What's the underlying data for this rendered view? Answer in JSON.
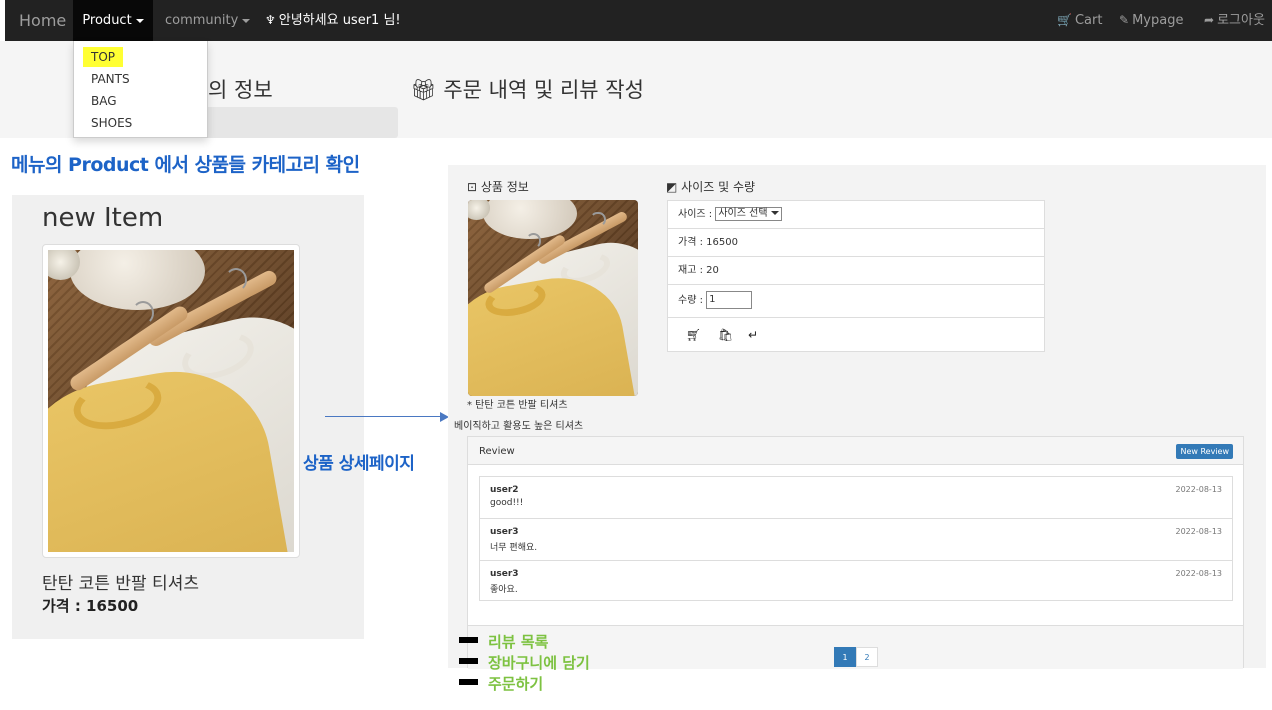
{
  "navbar": {
    "brand": "Home",
    "product": "Product",
    "community": "community",
    "greeting": "안녕하세요 user1 님!",
    "cart": "Cart",
    "mypage": "Mypage",
    "logout": "로그아웃"
  },
  "dropdown": {
    "items": [
      "TOP",
      "PANTS",
      "BAG",
      "SHOES"
    ]
  },
  "top_page": {
    "heading_left": "의 정보",
    "heading_right": "주문 내역 및 리뷰 작성"
  },
  "captions": {
    "menu_note": "메뉴의 Product 에서 상품들 카테고리 확인",
    "detail_note": "상품 상세페이지"
  },
  "left_card": {
    "title": "new Item",
    "product_name": "탄탄 코튼 반팔 티셔츠",
    "price_label": "가격 : 16500"
  },
  "detail": {
    "info_title": "상품 정보",
    "size_title": "사이즈 및 수량",
    "size_label": "사이즈 :",
    "size_select": "사이즈 선택",
    "price": "가격 : 16500",
    "stock": "재고 : 20",
    "qty_label": "수량 :",
    "qty_value": "1",
    "name": "* 탄탄 코튼 반팔 티셔츠",
    "desc": "베이직하고 활용도 높은 티셔츠"
  },
  "review": {
    "header": "Review",
    "new_button": "New Review",
    "items": [
      {
        "user": "user2",
        "text": "good!!!",
        "date": "2022-08-13"
      },
      {
        "user": "user3",
        "text": "너무 편해요.",
        "date": "2022-08-13"
      },
      {
        "user": "user3",
        "text": "좋아요.",
        "date": "2022-08-13"
      }
    ],
    "pages": [
      "1",
      "2"
    ]
  },
  "legend": {
    "items": [
      "리뷰 목록",
      "장바구니에 담기",
      "주문하기"
    ]
  },
  "colors": {
    "navbar": "#222222",
    "highlight": "#ffff33",
    "caption_blue": "#1d63c7",
    "legend_green": "#7dc241",
    "button_blue": "#337ab7"
  }
}
